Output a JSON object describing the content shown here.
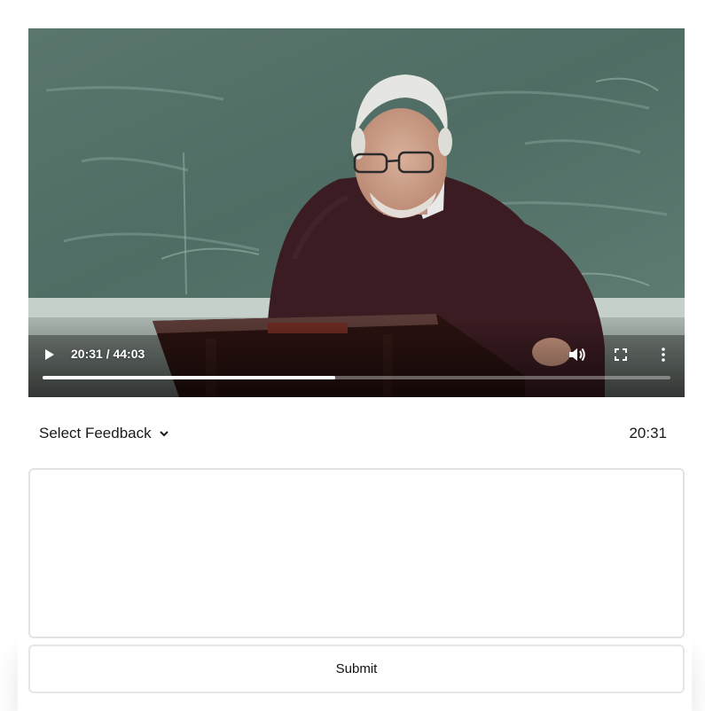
{
  "video": {
    "current_time": "20:31",
    "duration": "44:03",
    "time_display": "20:31 / 44:03",
    "progress_fraction": 0.466
  },
  "feedback": {
    "select_label": "Select Feedback",
    "timestamp": "20:31",
    "comment_value": ""
  },
  "submit_label": "Submit",
  "icons": {
    "play": "play-icon",
    "volume": "volume-icon",
    "fullscreen": "fullscreen-icon",
    "more": "more-vertical-icon",
    "chevron": "chevron-down-icon"
  },
  "colors": {
    "chalkboard": "#4d6b62",
    "sweater": "#3b1c22",
    "podium": "#2a1210"
  }
}
